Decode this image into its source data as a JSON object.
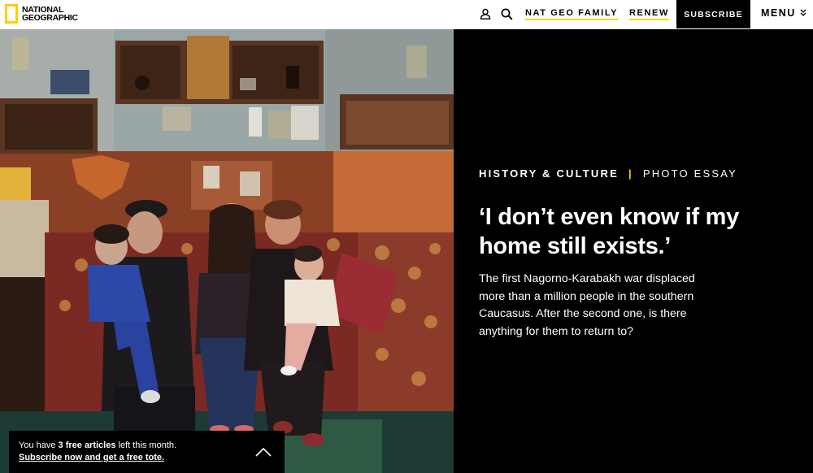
{
  "header": {
    "logo_line1": "NATIONAL",
    "logo_line2": "GEOGRAPHIC",
    "icons": [
      "user-icon",
      "search-icon"
    ],
    "nat_geo_family": "NAT GEO FAMILY",
    "renew": "RENEW",
    "subscribe": "SUBSCRIBE",
    "menu": "MENU",
    "accent_color": "#ffce00"
  },
  "article": {
    "category": "HISTORY & CULTURE",
    "separator": "|",
    "type": "PHOTO ESSAY",
    "headline": "‘I don’t even know if my home still exists.’",
    "dek": "The first Nagorno-Karabakh war displaced more than a million people in the southern Caucasus. After the second one, is there anything for them to return to?"
  },
  "notice": {
    "prefix": "You have ",
    "count": "3 free articles",
    "suffix": " left this month.",
    "cta": "Subscribe now and get a free tote."
  }
}
